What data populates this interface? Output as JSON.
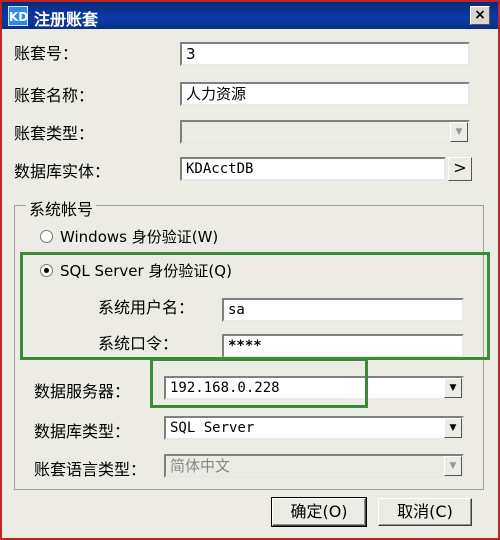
{
  "window": {
    "title": "注册账套",
    "icon_text": "KD",
    "close_label": "×",
    "close_icon": "close-icon"
  },
  "form": {
    "account_no": {
      "label": "账套号：",
      "value": "3"
    },
    "account_name": {
      "label": "账套名称：",
      "value": "人力资源"
    },
    "account_type": {
      "label": "账套类型：",
      "value": ""
    },
    "db_entity": {
      "label": "数据库实体：",
      "value": "KDAcctDB",
      "browse_label": ">"
    },
    "system_account": {
      "group_label": "系统帐号",
      "windows_auth": {
        "label": "Windows 身份验证(W)",
        "checked": false
      },
      "sql_auth": {
        "label": "SQL Server 身份验证(Q)",
        "checked": true
      },
      "username": {
        "label": "系统用户名：",
        "value": "sa"
      },
      "password": {
        "label": "系统口令：",
        "value": "****"
      }
    },
    "db_server": {
      "label": "数据服务器：",
      "value": "192.168.0.228"
    },
    "db_type": {
      "label": "数据库类型：",
      "value": "SQL Server"
    },
    "language": {
      "label": "账套语言类型：",
      "value": "简体中文"
    }
  },
  "buttons": {
    "ok": "确定(O)",
    "cancel": "取消(C)"
  },
  "dropdown_arrow": "▼",
  "highlight_color": "#3a8a3a"
}
